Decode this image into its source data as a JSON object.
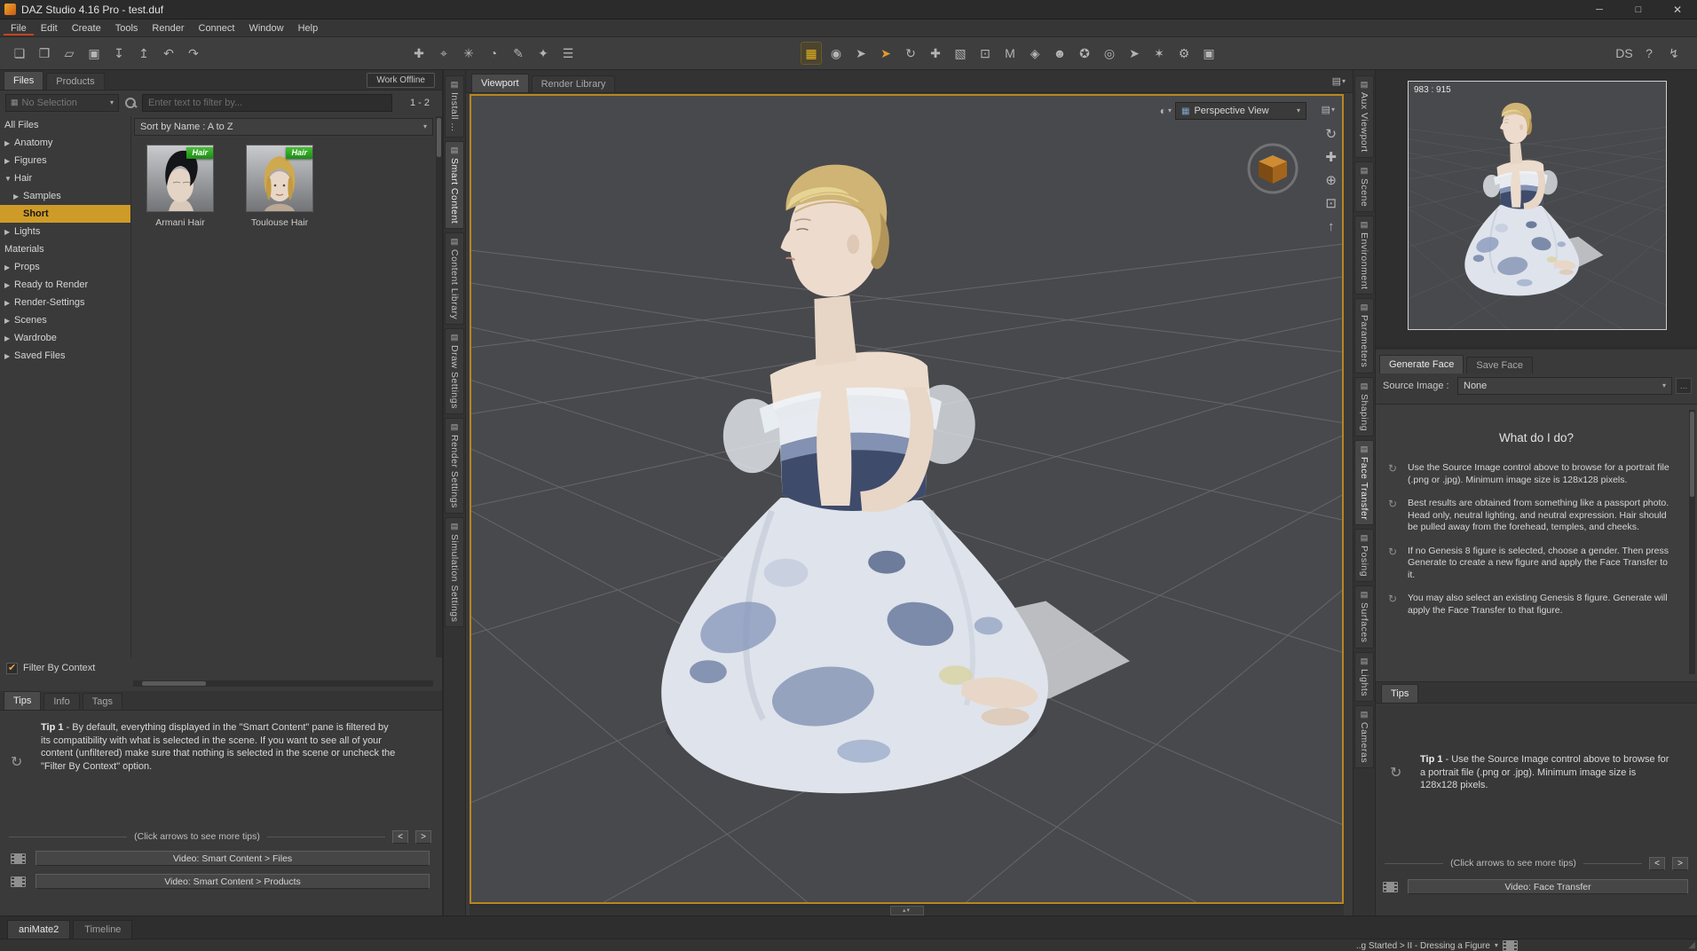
{
  "window": {
    "title": "DAZ Studio 4.16 Pro - test.duf"
  },
  "menu": [
    "File",
    "Edit",
    "Create",
    "Tools",
    "Render",
    "Connect",
    "Window",
    "Help"
  ],
  "icons": {
    "minimize": "─",
    "maximize": "□",
    "close": "✕",
    "pane": "▤",
    "caret": "▾",
    "view_grid": "▦",
    "small_grid": "▦",
    "opts_sphere": "◐",
    "refresh": "↻",
    "split_handle": "▴▾",
    "browse": "…"
  },
  "toolbar": {
    "file_icons": [
      {
        "n": "new-file-icon",
        "g": "❏"
      },
      {
        "n": "open-file-icon",
        "g": "❐"
      },
      {
        "n": "open-recent-icon",
        "g": "▱"
      },
      {
        "n": "save-icon",
        "g": "▣"
      },
      {
        "n": "save-as-icon",
        "g": "↧"
      },
      {
        "n": "export-icon",
        "g": "↥"
      },
      {
        "n": "undo-icon",
        "g": "↶"
      },
      {
        "n": "redo-icon",
        "g": "↷"
      }
    ],
    "create_icons": [
      {
        "n": "new-figure-icon",
        "g": "✚"
      },
      {
        "n": "node-align-icon",
        "g": "⌖"
      },
      {
        "n": "node-snap-icon",
        "g": "✳"
      },
      {
        "n": "node-timer-icon",
        "g": "◔"
      },
      {
        "n": "node-edit-icon",
        "g": "✎"
      },
      {
        "n": "node-star-icon",
        "g": "✦"
      },
      {
        "n": "list-options-icon",
        "g": "☰"
      }
    ],
    "tool_icons": [
      {
        "n": "smart-content-grid-icon",
        "g": "▦",
        "cls": "accent"
      },
      {
        "n": "scene-globe-icon",
        "g": "◉"
      },
      {
        "n": "node-selection-icon",
        "g": "➤"
      },
      {
        "n": "node-selection-alt-icon",
        "g": "➤",
        "cls": "orange"
      },
      {
        "n": "rotate-tool-icon",
        "g": "↻"
      },
      {
        "n": "translate-tool-icon",
        "g": "✚"
      },
      {
        "n": "scale-tool-icon",
        "g": "▧"
      },
      {
        "n": "frame-tool-icon",
        "g": "⊡"
      },
      {
        "n": "measure-tool-icon",
        "g": "M"
      },
      {
        "n": "geometry-tool-icon",
        "g": "◈"
      },
      {
        "n": "surface-tool-icon",
        "g": "☻"
      },
      {
        "n": "people-tool-icon",
        "g": "✪"
      },
      {
        "n": "camera-add-icon",
        "g": "◎"
      },
      {
        "n": "pointer-plus-icon",
        "g": "➤"
      },
      {
        "n": "wand-tool-icon",
        "g": "✶"
      },
      {
        "n": "gear-tool-icon",
        "g": "⚙"
      },
      {
        "n": "camera-view-icon",
        "g": "▣"
      }
    ],
    "right_icons": [
      {
        "n": "daz-store-icon",
        "g": "DS"
      },
      {
        "n": "help-icon",
        "g": "?"
      },
      {
        "n": "connect-status-icon",
        "g": "↯"
      }
    ]
  },
  "left_panel": {
    "tabs": [
      {
        "label": "Files",
        "cls": "active"
      },
      {
        "label": "Products",
        "cls": ""
      }
    ],
    "work_offline": "Work Offline",
    "filter": {
      "selection": "No Selection",
      "placeholder": "Enter text to filter by...",
      "count": "1 - 2"
    },
    "categories": [
      {
        "label": "All Files",
        "cls": "noarrow"
      },
      {
        "label": "Anatomy",
        "cls": "closed"
      },
      {
        "label": "Figures",
        "cls": "closed"
      },
      {
        "label": "Hair",
        "cls": "open"
      },
      {
        "label": "Samples",
        "cls": "closed child"
      },
      {
        "label": "Short",
        "cls": "selected child noarrow"
      },
      {
        "label": "Lights",
        "cls": "closed"
      },
      {
        "label": "Materials",
        "cls": "noarrow"
      },
      {
        "label": "Props",
        "cls": "closed"
      },
      {
        "label": "Ready to Render",
        "cls": "closed"
      },
      {
        "label": "Render-Settings",
        "cls": "closed"
      },
      {
        "label": "Scenes",
        "cls": "closed"
      },
      {
        "label": "Wardrobe",
        "cls": "closed"
      },
      {
        "label": "Saved Files",
        "cls": "closed"
      }
    ],
    "sort_label": "Sort by Name : A to Z",
    "items": [
      {
        "name": "Armani Hair",
        "badge": "Hair"
      },
      {
        "name": "Toulouse Hair",
        "badge": "Hair"
      }
    ],
    "filter_by_context": "Filter By Context",
    "info_tabs": [
      {
        "label": "Tips",
        "cls": "active"
      },
      {
        "label": "Info",
        "cls": ""
      },
      {
        "label": "Tags",
        "cls": ""
      }
    ],
    "tip_title": "Tip 1",
    "tip_body": "- By default, everything displayed in the \"Smart Content\" pane is filtered by its compatibility with what is selected in the scene. If you want to see all of your content (unfiltered) make sure that nothing is selected in the scene or uncheck the \"Filter By Context\" option.",
    "more_tips": "(Click arrows to see more tips)",
    "pager_prev": "<",
    "pager_next": ">",
    "videos": [
      "Video: Smart Content > Files",
      "Video: Smart Content > Products"
    ]
  },
  "dock_left": [
    {
      "label": "Install ...",
      "cls": ""
    },
    {
      "label": "Smart Content",
      "cls": "active"
    },
    {
      "label": "Content Library",
      "cls": ""
    },
    {
      "label": "Draw Settings",
      "cls": ""
    },
    {
      "label": "Render Settings",
      "cls": ""
    },
    {
      "label": "Simulation Settings",
      "cls": ""
    }
  ],
  "viewport": {
    "tabs": [
      {
        "label": "Viewport",
        "cls": "active"
      },
      {
        "label": "Render Library",
        "cls": ""
      }
    ],
    "camera": "Perspective View",
    "side_tools": [
      {
        "n": "orbit-rotate-icon",
        "g": "↻"
      },
      {
        "n": "pan-tool-icon",
        "g": "✚"
      },
      {
        "n": "zoom-tool-icon",
        "g": "⊕"
      },
      {
        "n": "frame-view-icon",
        "g": "⊡"
      },
      {
        "n": "reset-view-icon",
        "g": "↑"
      }
    ]
  },
  "dock_right": [
    {
      "label": "Aux Viewport",
      "cls": ""
    },
    {
      "label": "Scene",
      "cls": ""
    },
    {
      "label": "Environment",
      "cls": ""
    },
    {
      "label": "Parameters",
      "cls": ""
    },
    {
      "label": "Shaping",
      "cls": ""
    },
    {
      "label": "Face Transfer",
      "cls": "active"
    },
    {
      "label": "Posing",
      "cls": ""
    },
    {
      "label": "Surfaces",
      "cls": ""
    },
    {
      "label": "Lights",
      "cls": ""
    },
    {
      "label": "Cameras",
      "cls": ""
    }
  ],
  "right_panel": {
    "aux_coords": "983 : 915",
    "face_tabs": [
      {
        "label": "Generate Face",
        "cls": "active"
      },
      {
        "label": "Save Face",
        "cls": ""
      }
    ],
    "source_label": "Source Image :",
    "source_value": "None",
    "what_title": "What do I do?",
    "instructions": [
      "Use the Source Image control above to browse for a portrait file (.png or .jpg). Minimum image size is 128x128 pixels.",
      "Best results are obtained from something like a passport photo. Head only, neutral lighting, and neutral expression. Hair should be pulled away from the forehead, temples, and cheeks.",
      "If no Genesis 8 figure is selected, choose a gender. Then press Generate to create a new figure and apply the Face Transfer to it.",
      "You may also select an existing Genesis 8 figure. Generate will apply the Face Transfer to that figure."
    ],
    "tips_tab": "Tips",
    "tip_title": "Tip 1",
    "tip_body": "- Use the Source Image control above to browse for a portrait file (.png or .jpg). Minimum image size is 128x128 pixels.",
    "more_tips": "(Click arrows to see more tips)",
    "pager_prev": "<",
    "pager_next": ">",
    "video": "Video: Face Transfer"
  },
  "bottom": {
    "tabs": [
      {
        "label": "aniMate2",
        "cls": "active"
      },
      {
        "label": "Timeline",
        "cls": ""
      }
    ],
    "status": "..g Started > II - Dressing a Figure"
  },
  "colors": {
    "accent": "#d79a28",
    "selected_row": "#cf9b28",
    "badge_green": "#2fa12a",
    "viewport_border": "#b8871f"
  }
}
